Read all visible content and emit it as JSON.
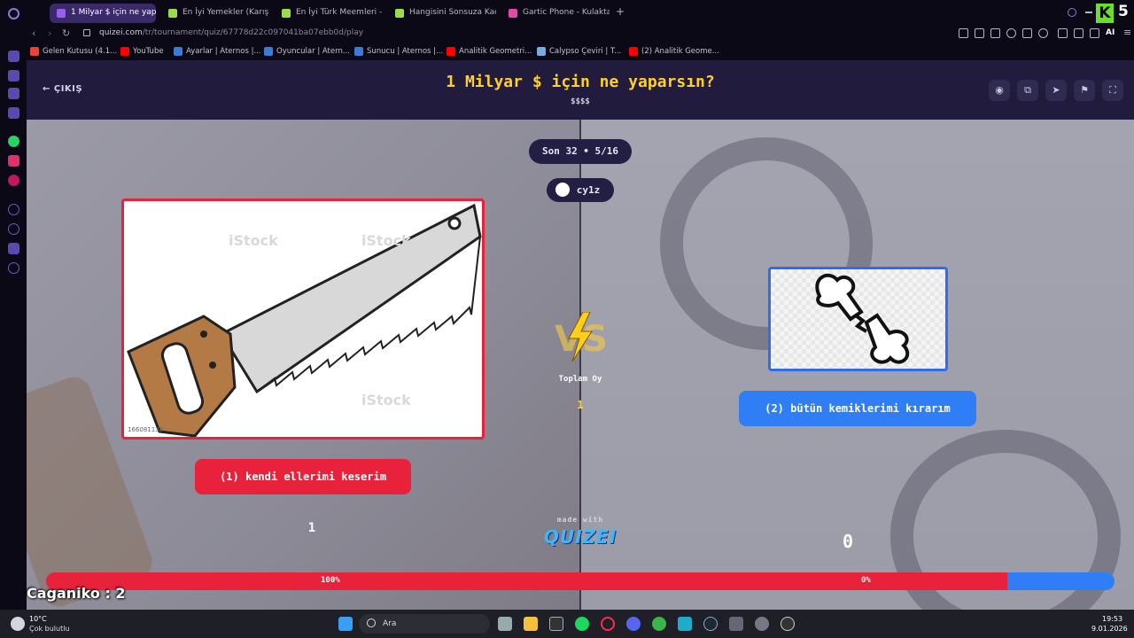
{
  "browser": {
    "tabs": [
      {
        "label": "1 Milyar $ için ne yaparsın",
        "active": true,
        "color": "#9b5cf0"
      },
      {
        "label": "En İyi Yemekler (Karışık)",
        "active": false,
        "color": "#9bdc4a"
      },
      {
        "label": "En İyi Türk Meemleri - Tie",
        "active": false,
        "color": "#9bdc4a"
      },
      {
        "label": "Hangisini Sonsuza Kadar",
        "active": false,
        "color": "#9bdc4a"
      },
      {
        "label": "Gartic Phone - Kulaktan Ku",
        "active": false,
        "color": "#e44aa5"
      }
    ],
    "url_host": "quizei.com",
    "url_path": "/tr/tournament/quiz/67778d22c097041ba07ebb0d/play",
    "ai_label": "AI",
    "bookmarks": [
      {
        "label": "Gelen Kutusu (4.1...",
        "color": "#ea4335"
      },
      {
        "label": "YouTube",
        "color": "#ff0000"
      },
      {
        "label": "Ayarlar | Aternos |...",
        "color": "#3a7bd5"
      },
      {
        "label": "Oyuncular | Atern...",
        "color": "#3a7bd5"
      },
      {
        "label": "Sunucu | Aternos |...",
        "color": "#3a7bd5"
      },
      {
        "label": "Analitik Geometri...",
        "color": "#ff0000"
      },
      {
        "label": "Calypso Çeviri | T...",
        "color": "#7ad"
      },
      {
        "label": "(2) Analitik Geome...",
        "color": "#ff0000"
      }
    ]
  },
  "quiz": {
    "exit_label": "ÇIKIŞ",
    "title": "1 Milyar $ için ne yaparsın?",
    "subtitle": "$$$$",
    "round_label": "Son 32 • 5/16",
    "user_label": "cy1z",
    "left": {
      "answer": "(1) kendi ellerimi keserim",
      "count": "1",
      "percent": "100%",
      "watermark": "iStock",
      "stock_id": "166081138"
    },
    "right": {
      "answer": "(2) bütün kemiklerimi kırarım",
      "count": "0",
      "percent": "0%"
    },
    "vs_label": "VS",
    "total_label": "Toplam Oy",
    "total_value": "1",
    "made_with": "made with",
    "brand": "QUIZEI",
    "progress_fraction": 0.9
  },
  "overlay": {
    "caganiko": "Caganiko : 2",
    "k_badge": "K",
    "k_count": "5"
  },
  "taskbar": {
    "weather_temp": "10°C",
    "weather_desc": "Çok bulutlu",
    "search_placeholder": "Ara",
    "time": "19:53",
    "date": "9.01.2026"
  }
}
